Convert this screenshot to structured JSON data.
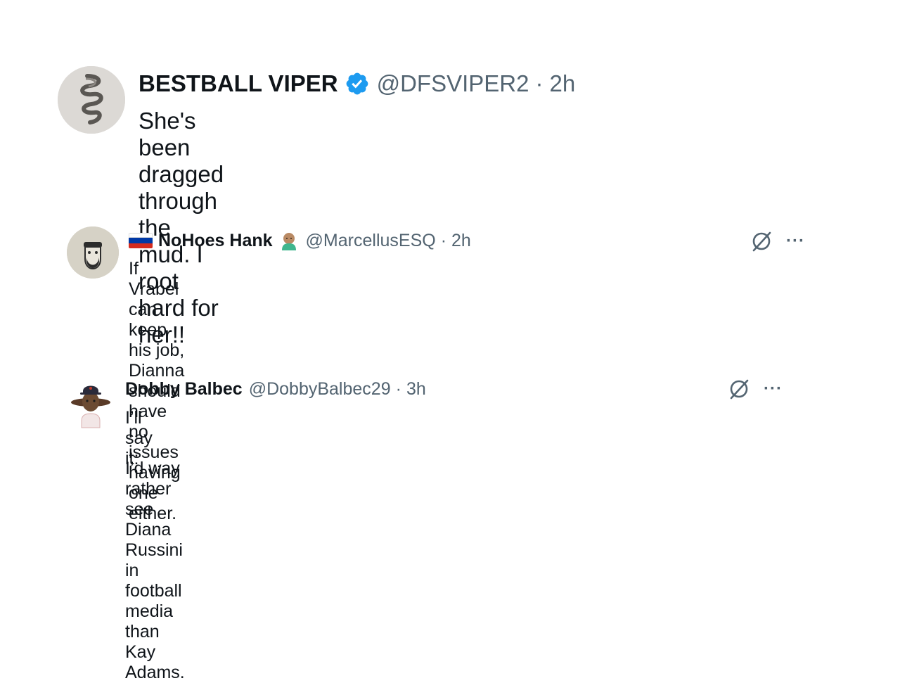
{
  "tweets": [
    {
      "name": "BESTBALL VIPER",
      "handle": "@DFSVIPER2",
      "separator": "·",
      "time": "2h",
      "text": "She's been dragged through the mud. I root hard for her!!",
      "verified": true
    },
    {
      "flag": "🇷🇺",
      "name": "NoHoes Hank",
      "emoji": "👨🏽‍🦲",
      "handle": "@MarcellusESQ",
      "separator": "·",
      "time": "2h",
      "text": "If Vrabel can keep his job, Dianna should have no issues having one either.",
      "more": "···"
    },
    {
      "name": "Dobby Balbec",
      "handle": "@DobbyBalbec29",
      "separator": "·",
      "time": "3h",
      "text_line1": "I’ll say it:",
      "text_line2": "I’d way rather see Diana Russini in football media than Kay Adams.",
      "more": "···"
    }
  ],
  "colors": {
    "text": "#0f1419",
    "secondary": "#536471",
    "verified": "#1d9bf0",
    "grok_icon": "#536471"
  },
  "icons": [
    "verified-badge-icon",
    "grok-icon",
    "more-icon",
    "russia-flag-icon"
  ]
}
